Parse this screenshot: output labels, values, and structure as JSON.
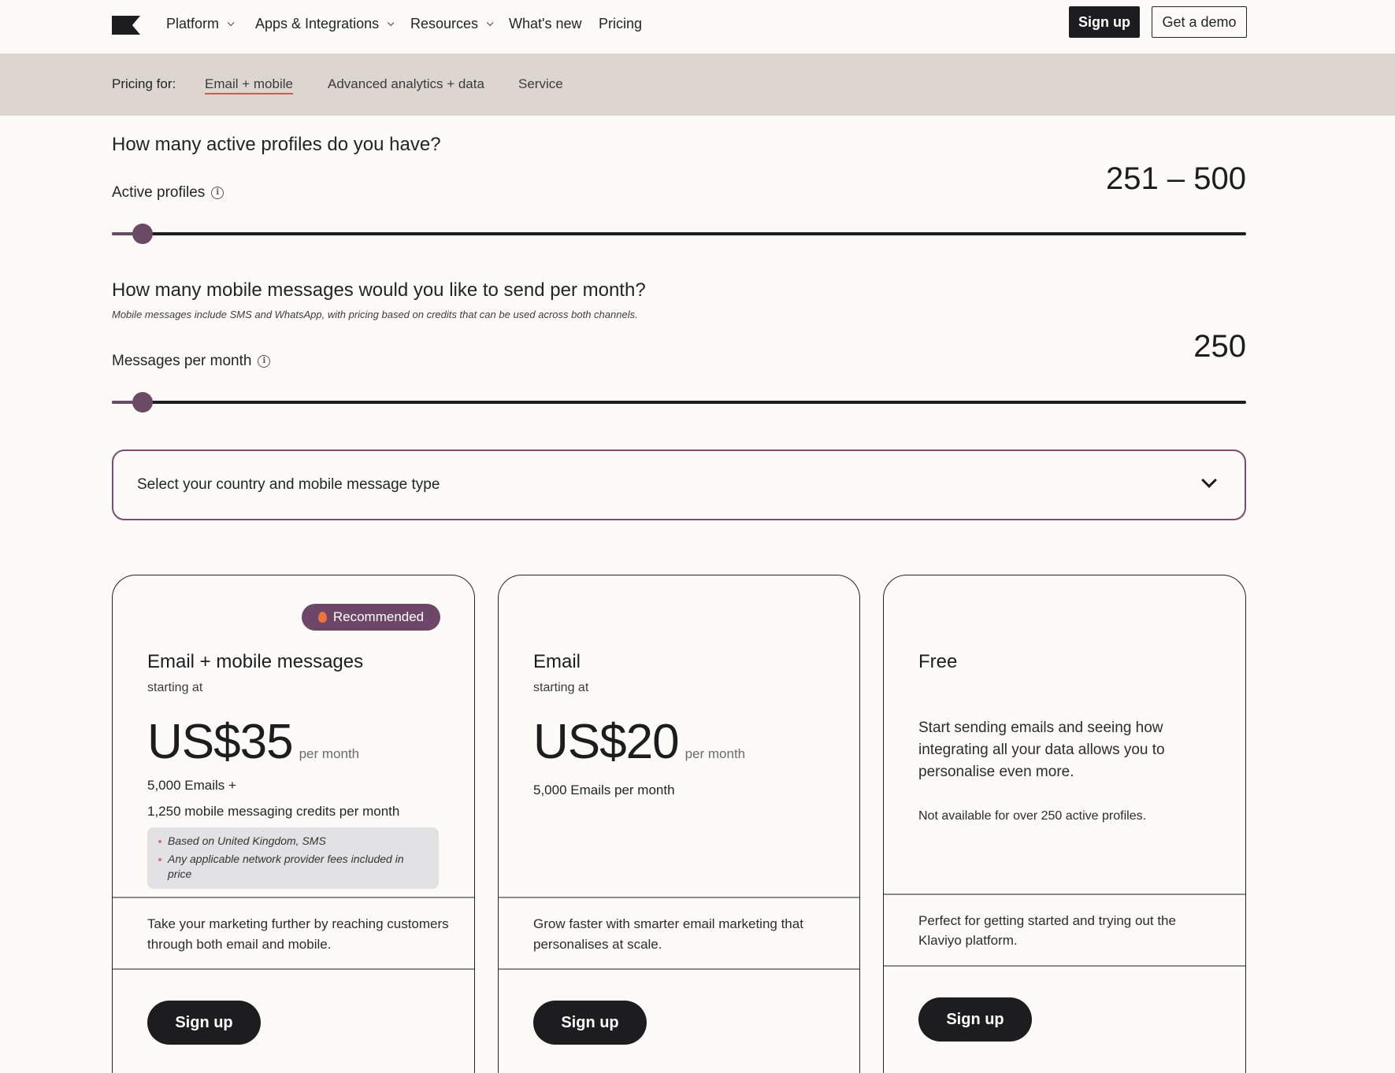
{
  "nav": {
    "items": [
      {
        "label": "Platform",
        "dropdown": true
      },
      {
        "label": "Apps & Integrations",
        "dropdown": true
      },
      {
        "label": "Resources",
        "dropdown": true
      },
      {
        "label": "What's new",
        "dropdown": false
      },
      {
        "label": "Pricing",
        "dropdown": false
      }
    ],
    "signup_label": "Sign up",
    "demo_label": "Get a demo"
  },
  "pricing_for": {
    "label": "Pricing for:",
    "tabs": [
      {
        "label": "Email + mobile",
        "active": true
      },
      {
        "label": "Advanced analytics + data",
        "active": false
      },
      {
        "label": "Service",
        "active": false
      }
    ]
  },
  "profiles": {
    "question": "How many active profiles do you have?",
    "label": "Active profiles",
    "value": "251 – 500",
    "slider_position": 0.027
  },
  "messages": {
    "question": "How many mobile messages would you like to send per month?",
    "subtext": "Mobile messages include SMS and WhatsApp, with pricing based on credits that can be used across both channels.",
    "label": "Messages per month",
    "value": "250",
    "slider_position": 0.027
  },
  "country_select": {
    "placeholder": "Select your country and mobile message type"
  },
  "plans": [
    {
      "badge": "Recommended",
      "name": "Email + mobile messages",
      "starting": "starting at",
      "price": "US$35",
      "per": "per month",
      "features": [
        "5,000 Emails +",
        "1,250 mobile messaging credits per month"
      ],
      "notes": [
        "Based on United Kingdom, SMS",
        "Any applicable network provider fees included in price"
      ],
      "description": "Take your marketing further by reaching customers through both email and mobile.",
      "cta": "Sign up"
    },
    {
      "name": "Email",
      "starting": "starting at",
      "price": "US$20",
      "per": "per month",
      "features": [
        "5,000 Emails per month"
      ],
      "description": "Grow faster with smarter email marketing that personalises at scale.",
      "cta": "Sign up"
    },
    {
      "name": "Free",
      "body": "Start sending emails and seeing how integrating all your data allows you to personalise even more.",
      "note": "Not available for over 250 active profiles.",
      "description": "Perfect for getting started and trying out the Klaviyo platform.",
      "cta": "Sign up"
    }
  ],
  "colors": {
    "accent": "#6b4a64",
    "dark": "#1d1d1f",
    "bar_bg": "#dcd6cf",
    "page_bg": "#fdfbf8"
  }
}
